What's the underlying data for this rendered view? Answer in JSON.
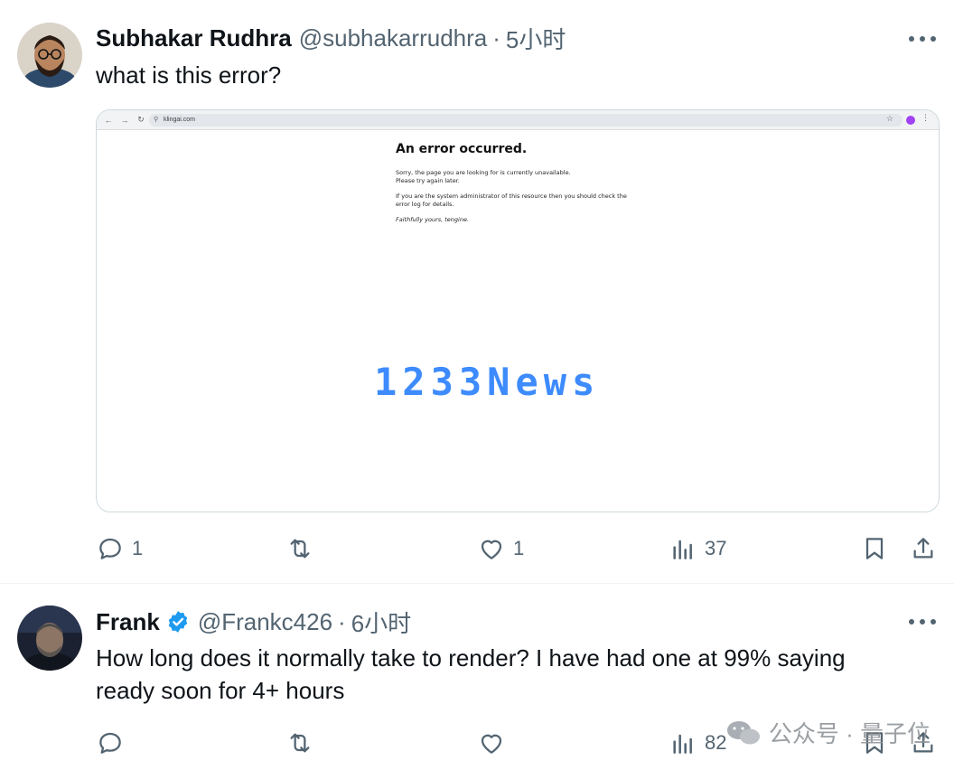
{
  "tweets": [
    {
      "name": "Subhakar Rudhra",
      "handle": "@subhakarrudhra",
      "time": "5小时",
      "text": "what is this error?",
      "media": {
        "url": "klingai.com",
        "error_title": "An error occurred.",
        "line1": "Sorry, the page you are looking for is currently unavailable.",
        "line2": "Please try again later.",
        "line3": "If you are the system administrator of this resource then you should check the",
        "line4": "error log for details.",
        "signature": "Faithfully yours, tengine.",
        "watermark": "1233News"
      },
      "actions": {
        "replies": "1",
        "retweets": "",
        "likes": "1",
        "views": "37"
      }
    },
    {
      "name": "Frank",
      "handle": "@Frankc426",
      "time": "6小时",
      "text": "How long does it normally take to render? I have had one at 99% saying ready soon for 4+ hours",
      "actions": {
        "replies": "",
        "retweets": "",
        "likes": "",
        "views": "82"
      }
    }
  ],
  "footer_watermark": "公众号 · 量子位",
  "colors": {
    "verified": "#1d9bf0",
    "muted": "#536471",
    "watermark": "#3d8bfd"
  },
  "icons": [
    "reply-icon",
    "retweet-icon",
    "like-icon",
    "views-icon",
    "bookmark-icon",
    "share-icon",
    "more-icon",
    "verified-badge-icon"
  ]
}
